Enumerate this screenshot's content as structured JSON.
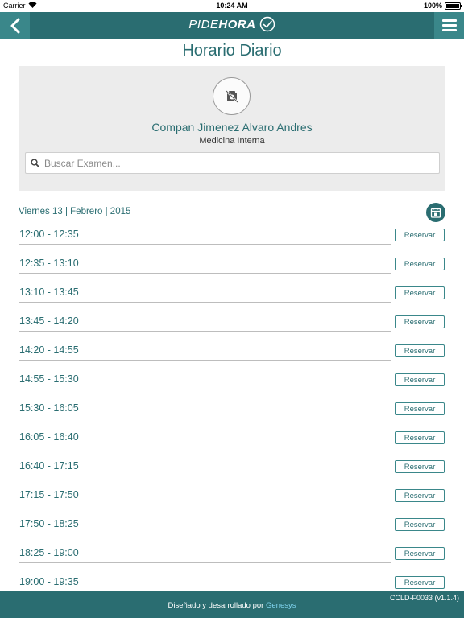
{
  "status_bar": {
    "carrier": "Carrier",
    "time": "10:24 AM",
    "battery": "100%",
    "battery_level": 1.0
  },
  "nav": {
    "logo_part1": "PIDE",
    "logo_part2": "HORA",
    "back_icon": "chevron-left-icon",
    "menu_icon": "hamburger-icon"
  },
  "page": {
    "title": "Horario Diario"
  },
  "doctor": {
    "name": "Compan Jimenez Alvaro Andres",
    "specialty": "Medicina Interna",
    "avatar_icon": "no-photo-icon"
  },
  "search": {
    "placeholder": "Buscar Examen...",
    "value": ""
  },
  "schedule": {
    "date": "Viernes 13 | Febrero | 2015",
    "calendar_icon": "calendar-icon",
    "reserve_label": "Reservar",
    "slots": [
      {
        "time": "12:00 - 12:35",
        "action": "Reservar"
      },
      {
        "time": "12:35 - 13:10",
        "action": "Reservar"
      },
      {
        "time": "13:10 - 13:45",
        "action": "Reservar"
      },
      {
        "time": "13:45 - 14:20",
        "action": "Reservar"
      },
      {
        "time": "14:20 - 14:55",
        "action": "Reservar"
      },
      {
        "time": "14:55 - 15:30",
        "action": "Reservar"
      },
      {
        "time": "15:30 - 16:05",
        "action": "Reservar"
      },
      {
        "time": "16:05 - 16:40",
        "action": "Reservar"
      },
      {
        "time": "16:40 - 17:15",
        "action": "Reservar"
      },
      {
        "time": "17:15 - 17:50",
        "action": "Reservar"
      },
      {
        "time": "17:50 - 18:25",
        "action": "Reservar"
      },
      {
        "time": "18:25 - 19:00",
        "action": "Reservar"
      },
      {
        "time": "19:00 - 19:35",
        "action": "Reservar"
      }
    ]
  },
  "footer": {
    "version": "CCLD-F0033 (v1.1.4)",
    "credit_text": "Diseñado y desarrollado por",
    "credit_brand": "Genesys"
  },
  "colors": {
    "primary": "#2a6d71",
    "primary_light": "#3a878a",
    "card_background": "#ececec",
    "brand_link": "#7fd3ee"
  }
}
